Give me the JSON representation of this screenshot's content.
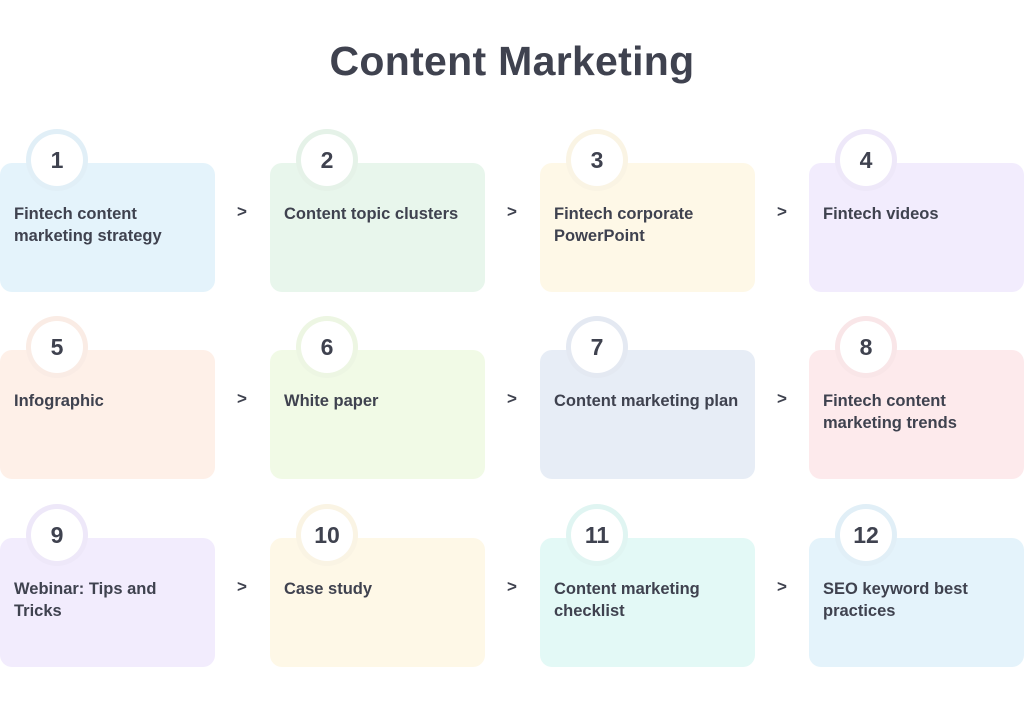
{
  "title": "Content Marketing",
  "arrow_glyph": ">",
  "steps": [
    {
      "number": "1",
      "label": "Fintech content marketing strategy",
      "color": "#e4f3fb"
    },
    {
      "number": "2",
      "label": "Content topic clusters",
      "color": "#e8f6ec"
    },
    {
      "number": "3",
      "label": "Fintech corporate PowerPoint",
      "color": "#fef8e7"
    },
    {
      "number": "4",
      "label": "Fintech videos",
      "color": "#f2ecfd"
    },
    {
      "number": "5",
      "label": "Infographic",
      "color": "#fef0e8"
    },
    {
      "number": "6",
      "label": "White paper",
      "color": "#f1fae6"
    },
    {
      "number": "7",
      "label": "Content marketing plan",
      "color": "#e7edf6"
    },
    {
      "number": "8",
      "label": "Fintech content marketing trends",
      "color": "#fdeaec"
    },
    {
      "number": "9",
      "label": "Webinar: Tips and Tricks",
      "color": "#f2ecfd"
    },
    {
      "number": "10",
      "label": "Case study",
      "color": "#fef8e7"
    },
    {
      "number": "11",
      "label": "Content marketing checklist",
      "color": "#e3f9f6"
    },
    {
      "number": "12",
      "label": "SEO keyword best practices",
      "color": "#e4f3fb"
    }
  ]
}
